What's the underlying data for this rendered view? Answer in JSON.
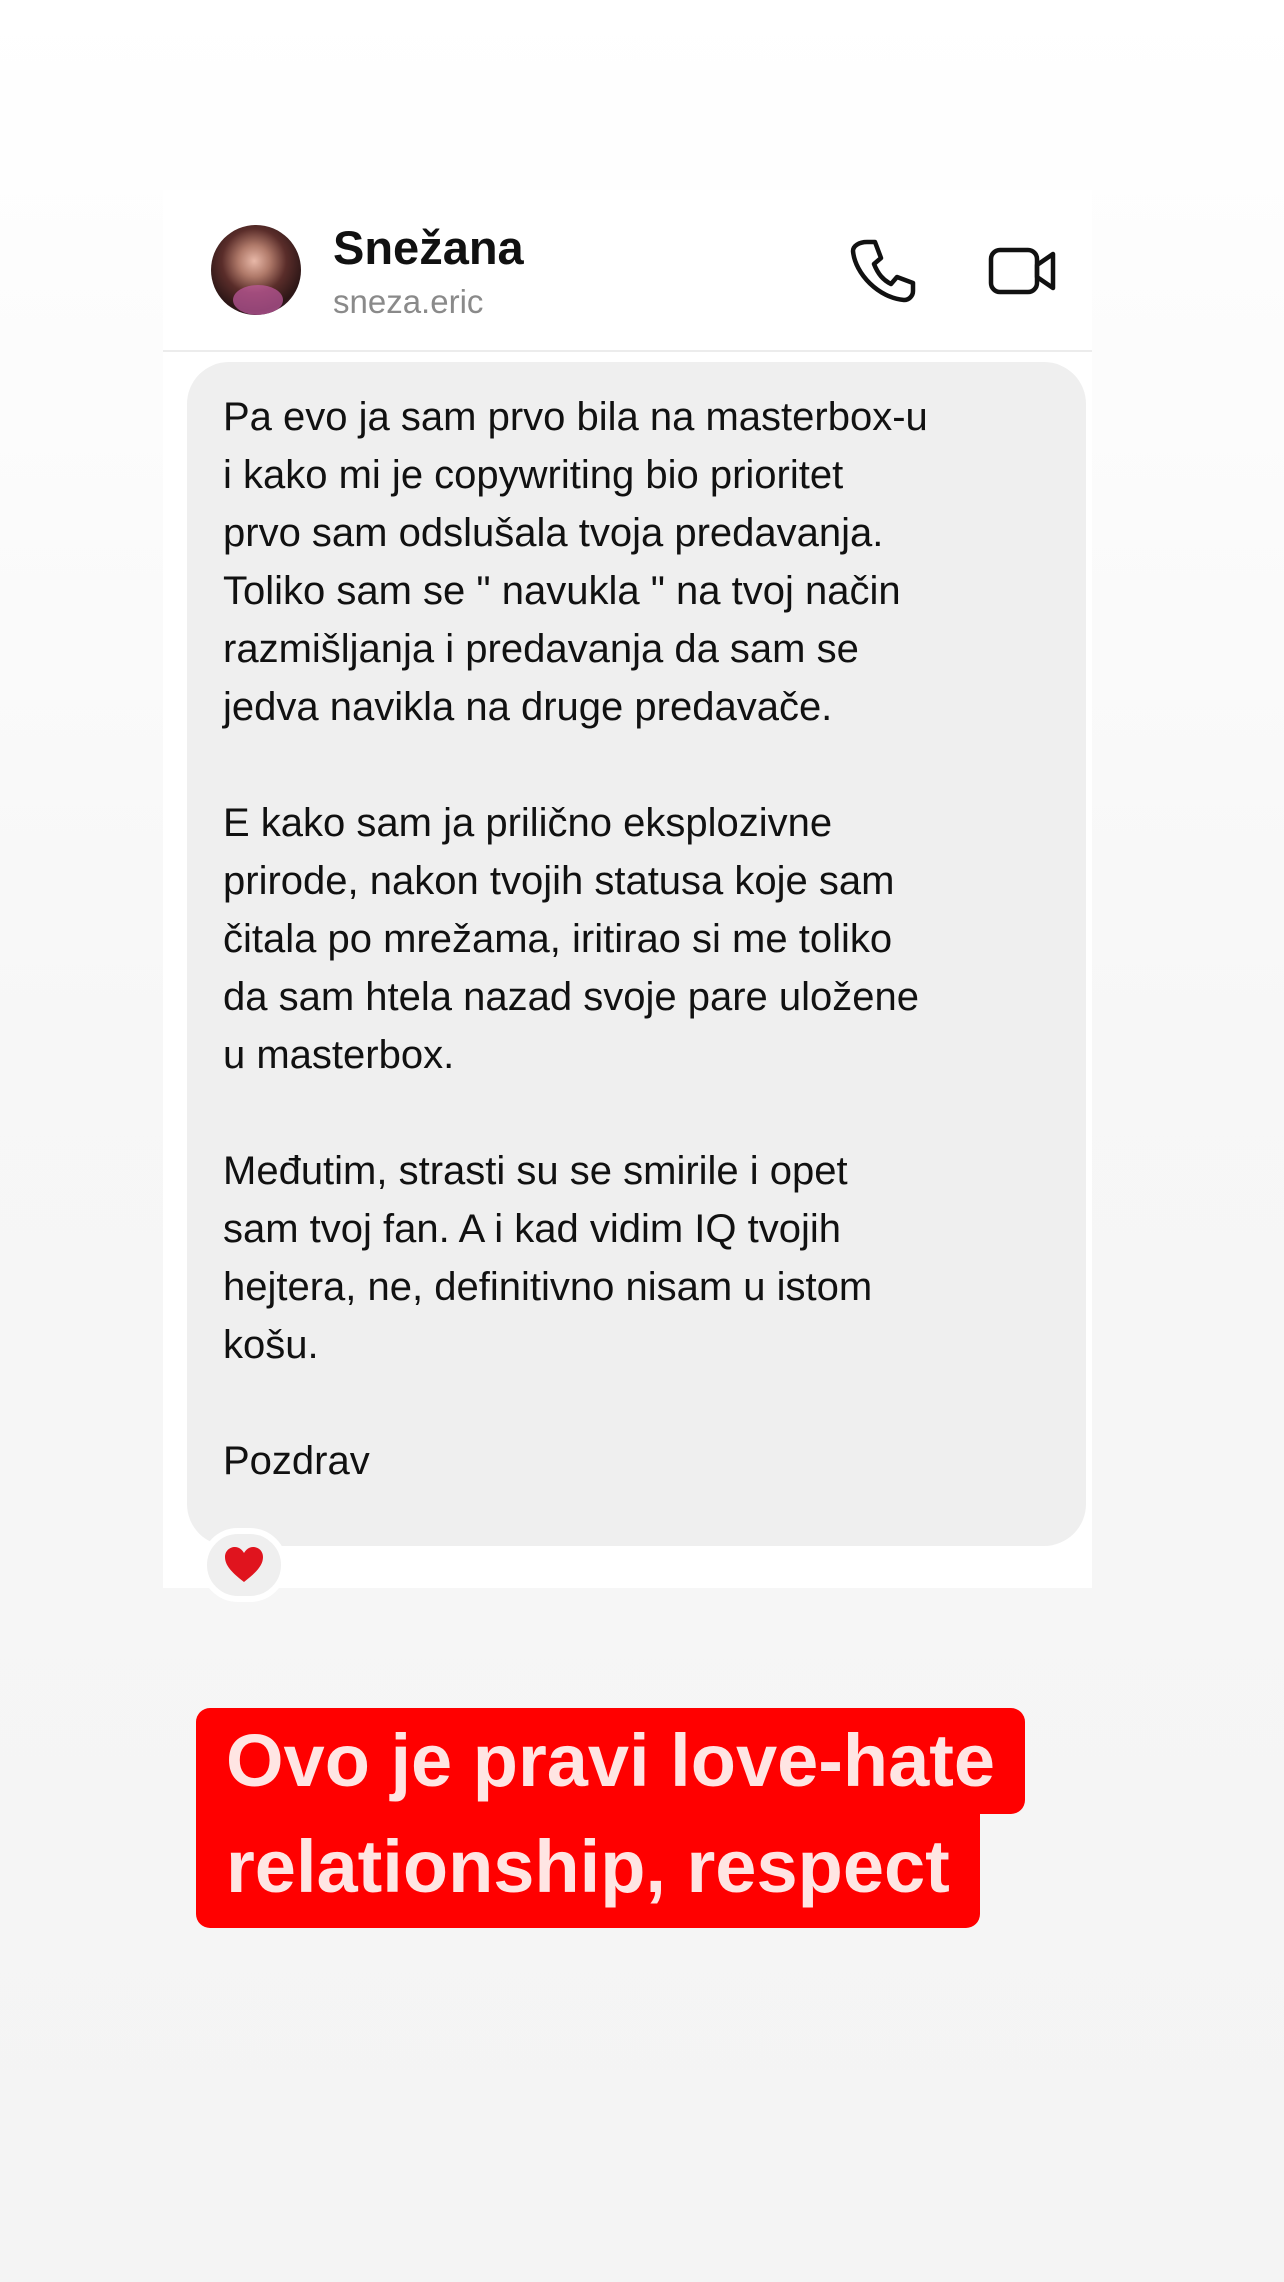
{
  "contact": {
    "name": "Snežana",
    "handle": "sneza.eric"
  },
  "header_icons": [
    "phone-icon",
    "video-camera-icon"
  ],
  "message": {
    "paragraphs": [
      [
        "Pa evo ja sam prvo bila na masterbox-u",
        "i kako mi je copywriting bio prioritet",
        "prvo sam odslušala tvoja predavanja.",
        "Toliko sam se \" navukla \" na tvoj način",
        "razmišljanja i predavanja da sam se",
        "jedva navikla na druge predavače."
      ],
      [
        "E kako sam ja prilično eksplozivne",
        "prirode, nakon tvojih statusa koje sam",
        "čitala po mrežama, iritirao si me toliko",
        "da sam htela nazad svoje pare uložene",
        "u masterbox."
      ],
      [
        "Međutim, strasti su se smirile i opet",
        "sam tvoj fan. A i kad vidim IQ tvojih",
        "hejtera, ne, definitivno nisam u istom",
        "košu."
      ],
      [
        "Pozdrav"
      ]
    ],
    "reaction": "heart-icon"
  },
  "caption": {
    "lines": [
      "Ovo je pravi love-hate",
      "relationship, respect"
    ]
  },
  "colors": {
    "caption_background": "#ff0000",
    "caption_text": "#ffe5e3",
    "bubble": "#efefef",
    "heart": "#e0141e"
  }
}
